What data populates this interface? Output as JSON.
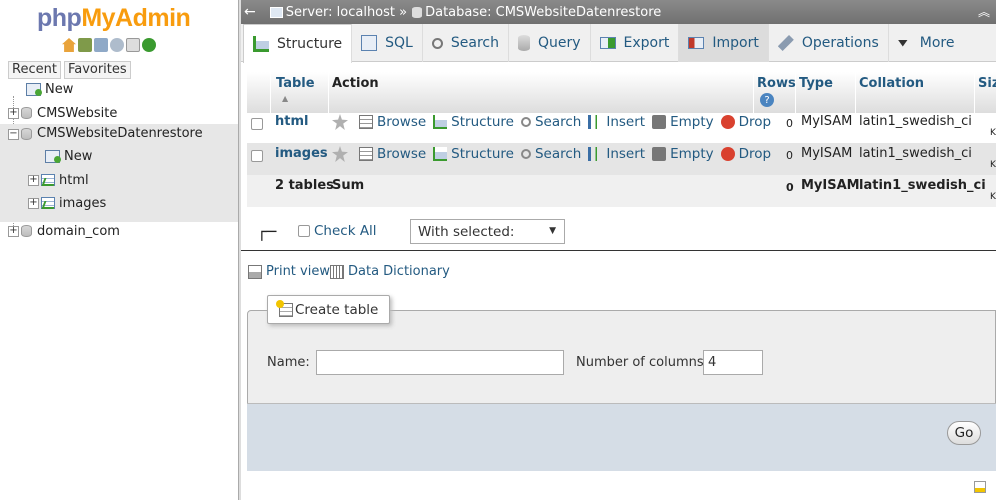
{
  "logo": {
    "php": "php",
    "admin": "MyAdmin"
  },
  "nav": {
    "recent": "Recent",
    "favorites": "Favorites",
    "tree": {
      "new": "New",
      "db1": "CMSWebsite",
      "db2": "CMSWebsiteDatenrestore",
      "db2_new": "New",
      "db2_table1": "html",
      "db2_table2": "images",
      "db3": "domain_com"
    }
  },
  "breadcrumb": {
    "server": "Server: localhost »",
    "database": "Database: CMSWebsiteDatenrestore"
  },
  "tabs": [
    {
      "label": "Structure"
    },
    {
      "label": "SQL"
    },
    {
      "label": "Search"
    },
    {
      "label": "Query"
    },
    {
      "label": "Export"
    },
    {
      "label": "Import"
    },
    {
      "label": "Operations"
    },
    {
      "label": "More"
    }
  ],
  "table": {
    "headers": {
      "table": "Table",
      "action": "Action",
      "rows": "Rows",
      "type": "Type",
      "collation": "Collation",
      "size": "Siz"
    },
    "actions": {
      "browse": "Browse",
      "structure": "Structure",
      "search": "Search",
      "insert": "Insert",
      "empty": "Empty",
      "drop": "Drop"
    },
    "rows": [
      {
        "name": "html",
        "rows": "0",
        "type": "MyISAM",
        "collation": "latin1_swedish_ci",
        "size": "K"
      },
      {
        "name": "images",
        "rows": "0",
        "type": "MyISAM",
        "collation": "latin1_swedish_ci",
        "size": "K"
      }
    ],
    "summary": {
      "name": "2 tables",
      "label": "Sum",
      "rows": "0",
      "type": "MyISAM",
      "collation": "latin1_swedish_ci",
      "size": "K"
    }
  },
  "controls": {
    "check_all": "Check All",
    "with_selected": "With selected:",
    "print_view": "Print view",
    "data_dictionary": "Data Dictionary"
  },
  "create_table": {
    "legend": "Create table",
    "name_label": "Name:",
    "name_value": "",
    "columns_label": "Number of columns:",
    "columns_value": "4",
    "go": "Go"
  },
  "colors": {
    "link": "#235a81",
    "logo_php": "#6c78af",
    "logo_admin": "#f89c0e"
  }
}
